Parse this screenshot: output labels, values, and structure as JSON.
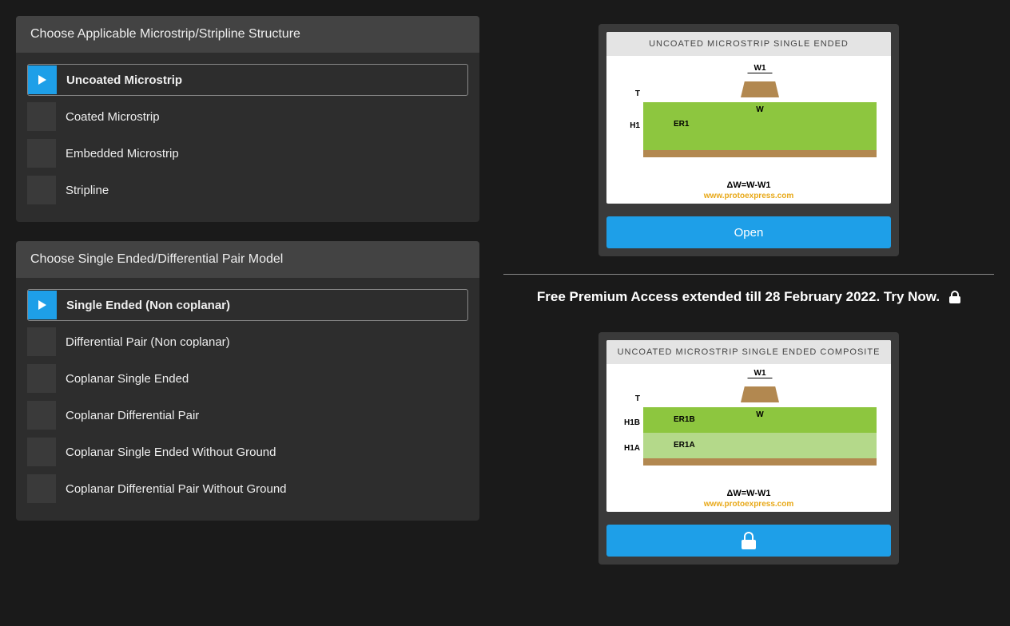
{
  "panel1": {
    "title": "Choose Applicable Microstrip/Stripline Structure",
    "options": [
      "Uncoated Microstrip",
      "Coated Microstrip",
      "Embedded Microstrip",
      "Stripline"
    ]
  },
  "panel2": {
    "title": "Choose Single Ended/Differential Pair Model",
    "options": [
      "Single Ended (Non coplanar)",
      "Differential Pair (Non coplanar)",
      "Coplanar Single Ended",
      "Coplanar Differential Pair",
      "Coplanar Single Ended Without Ground",
      "Coplanar Differential Pair Without Ground"
    ]
  },
  "card1": {
    "title": "UNCOATED MICROSTRIP SINGLE ENDED",
    "labels": {
      "w1": "W1",
      "w": "W",
      "er1": "ER1",
      "h1": "H1",
      "t": "T"
    },
    "delta": "ΔW=W-W1",
    "site": "www.protoexpress.com",
    "button": "Open"
  },
  "promo": "Free Premium Access extended till 28 February 2022. Try Now.",
  "card2": {
    "title": "UNCOATED MICROSTRIP SINGLE ENDED COMPOSITE",
    "labels": {
      "w1": "W1",
      "w": "W",
      "er1a": "ER1A",
      "er1b": "ER1B",
      "h1a": "H1A",
      "h1b": "H1B",
      "t": "T"
    },
    "delta": "ΔW=W-W1",
    "site": "www.protoexpress.com"
  }
}
